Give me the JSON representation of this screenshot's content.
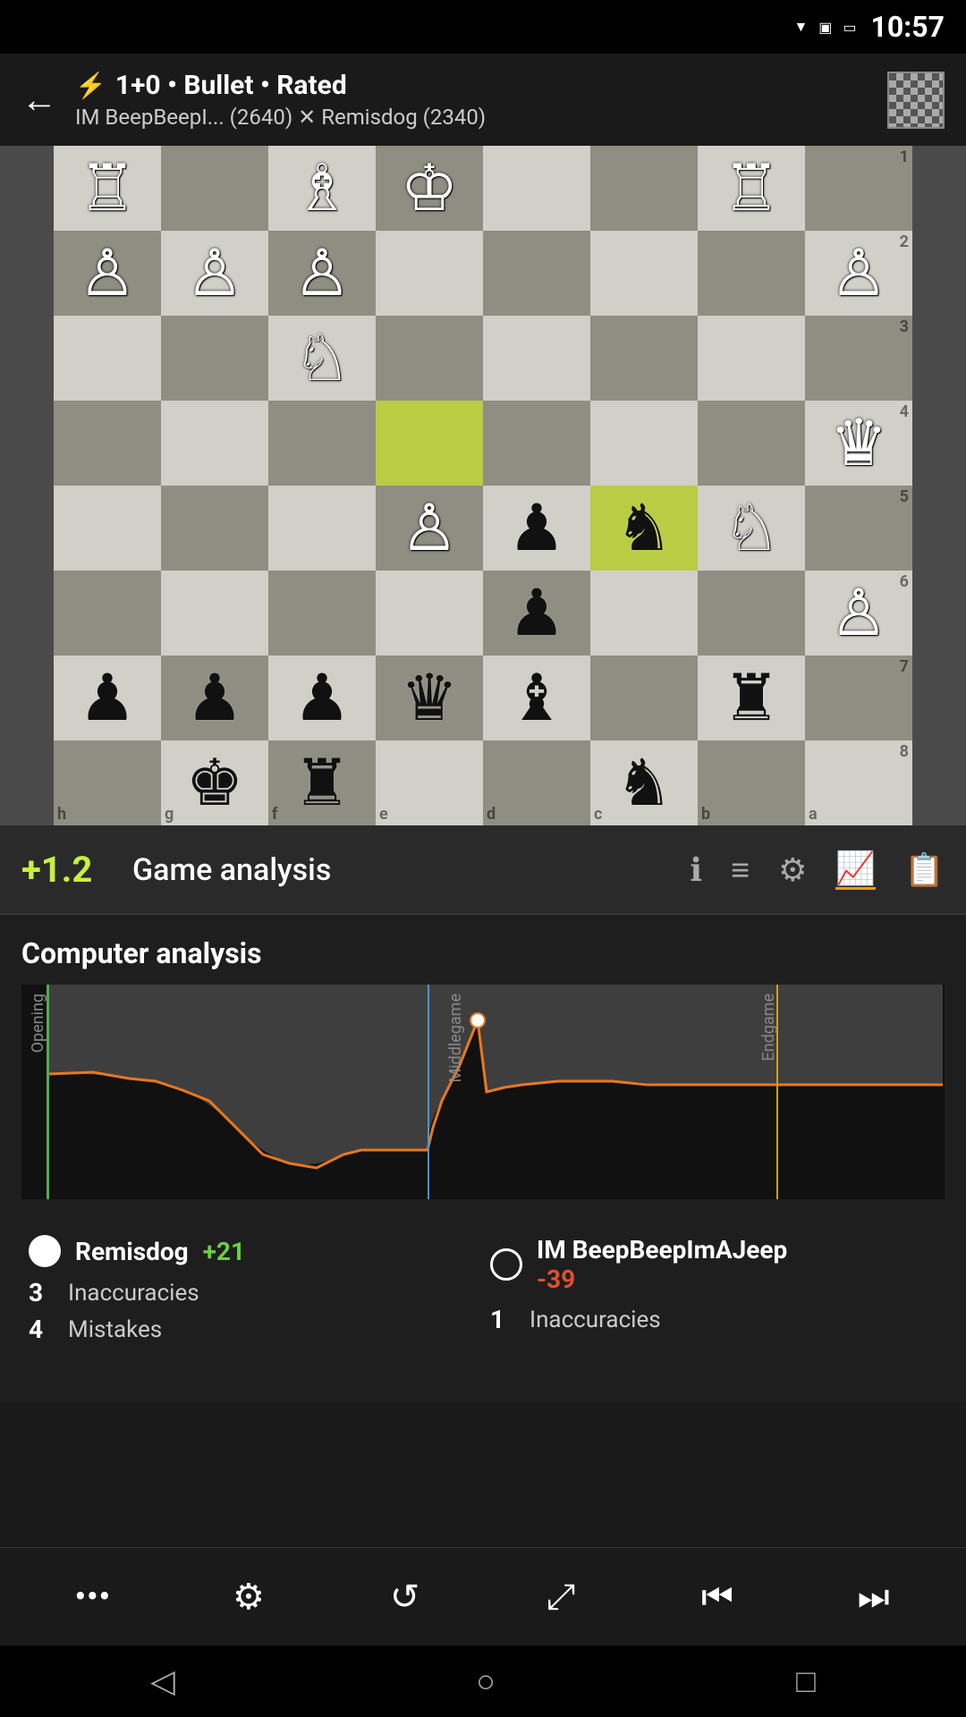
{
  "statusBar": {
    "time": "10:57"
  },
  "header": {
    "backLabel": "←",
    "bolt": "⚡",
    "title": "1+0 • Bullet • Rated",
    "players": "IM BeepBeepI... (2640) ✕ Remisdog (2340)"
  },
  "analysisBar": {
    "eval": "+1.2",
    "title": "Game analysis",
    "icons": [
      "ℹ",
      "≡",
      "⚙",
      "📈",
      "📋"
    ]
  },
  "computerAnalysis": {
    "sectionTitle": "Computer analysis",
    "chartLabels": {
      "opening": "Opening",
      "middlegame": "Middlegame",
      "endgame": "Endgame"
    },
    "players": [
      {
        "name": "Remisdog",
        "score": "+21",
        "scoreType": "positive",
        "dotType": "filled",
        "stats": [
          {
            "number": "3",
            "label": "Inaccuracies"
          },
          {
            "number": "4",
            "label": "Mistakes"
          }
        ]
      },
      {
        "name": "IM BeepBeepImAJeep",
        "score": "-39",
        "scoreType": "negative",
        "dotType": "outline",
        "stats": [
          {
            "number": "1",
            "label": "Inaccuracies"
          }
        ]
      }
    ]
  },
  "toolbar": {
    "buttons": [
      "•••",
      "⚙",
      "↺",
      "⤢",
      "⏮",
      "⏭"
    ]
  },
  "navBar": {
    "buttons": [
      "◁",
      "○",
      "□"
    ]
  },
  "board": {
    "files": [
      "h",
      "g",
      "f",
      "e",
      "d",
      "c",
      "b",
      "a"
    ],
    "ranks": [
      "1",
      "2",
      "3",
      "4",
      "5",
      "6",
      "7",
      "8"
    ]
  }
}
